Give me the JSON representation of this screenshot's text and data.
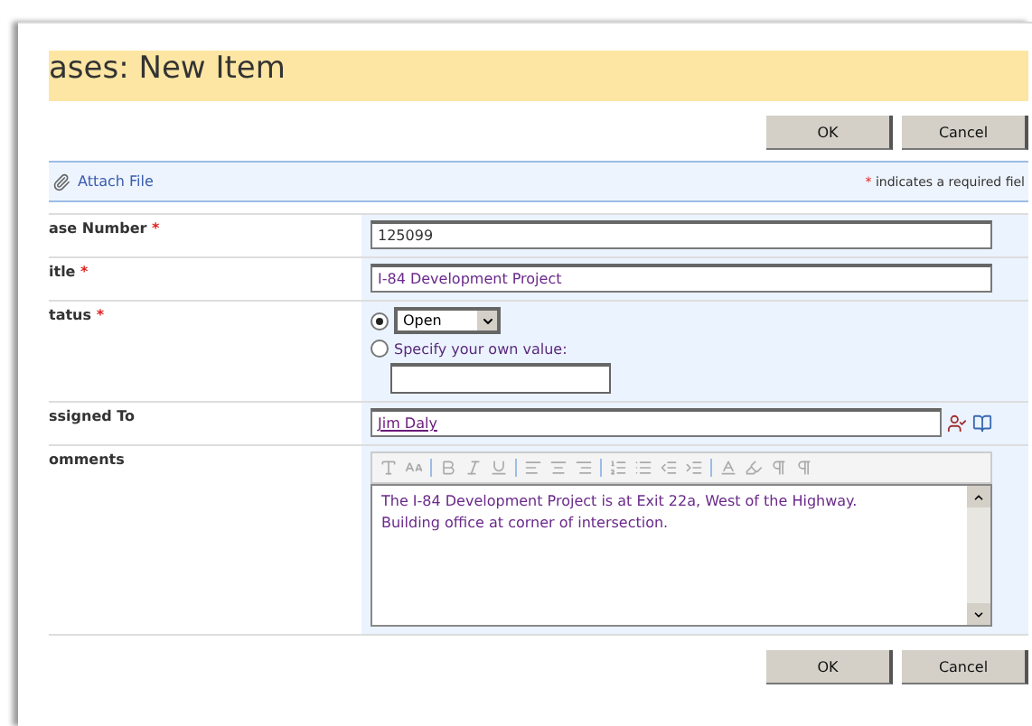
{
  "page_title": "ases: New Item",
  "top_buttons": [
    {
      "label": "OK"
    },
    {
      "label": "Cancel"
    }
  ],
  "attach_link": "Attach File",
  "required_notice": {
    "mark": "*",
    "text": "indicates a required fiel"
  },
  "fields": [
    {
      "kind": "text",
      "label": "ase Number",
      "required_mark": "*",
      "value": "125099"
    },
    {
      "kind": "text",
      "label": "itle",
      "required_mark": "*",
      "value": "I-84 Development Project"
    },
    {
      "kind": "choice",
      "label": "tatus",
      "required_mark": "*",
      "options": [
        {
          "kind": "dropdown",
          "value": "Open",
          "selected": true
        },
        {
          "kind": "custom",
          "label": "Specify your own value:",
          "selected": false
        }
      ]
    },
    {
      "kind": "people",
      "label": "ssigned To",
      "value": "Jim Daly"
    },
    {
      "kind": "richtext",
      "label": "omments",
      "value": "The I-84 Development Project is at Exit 22a, West of the Highway.  Building office at corner of intersection."
    }
  ],
  "bottom_buttons": [
    {
      "label": "OK"
    },
    {
      "label": "Cancel"
    }
  ]
}
